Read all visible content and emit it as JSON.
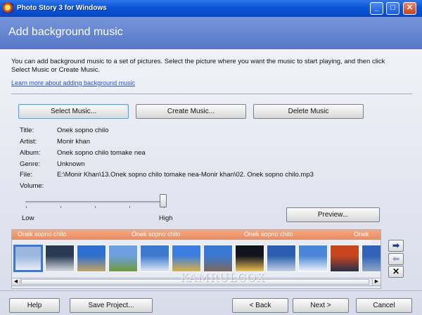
{
  "window": {
    "title": "Photo Story 3 for Windows"
  },
  "titlebar_buttons": {
    "minimize": "_",
    "maximize": "□",
    "close": "✕"
  },
  "header": {
    "title": "Add background music"
  },
  "instructions": "You can add background music to a set of pictures.  Select the picture where you want the music to start playing, and then click Select Music or Create Music.",
  "help_link": "Learn more about adding background music",
  "buttons": {
    "select_music": "Select Music...",
    "create_music": "Create Music...",
    "delete_music": "Delete Music",
    "preview": "Preview..."
  },
  "details": {
    "title_label": "Title:",
    "title": "Onek sopno chilo",
    "artist_label": "Artist:",
    "artist": "Monir khan",
    "album_label": "Album:",
    "album": "Onek sopno chilo tomake nea",
    "genre_label": "Genre:",
    "genre": "Unknown",
    "file_label": "File:",
    "file": "E:\\Monir Khan\\13.Onek sopno chilo tomake nea-Monir khan\\02. Onek sopno chilo.mp3",
    "volume_label": "Volume:"
  },
  "volume": {
    "low": "Low",
    "high": "High",
    "level_fraction": 0.98
  },
  "timeline": {
    "music_labels": [
      "Onek sopno chilo",
      "Onek sopno chilo",
      "Onek sopno chilo",
      "Onek sopno chilo"
    ],
    "thumbnails": [
      {
        "name": "winter-sky",
        "colors": [
          "#9bb7dd",
          "#e8eef8"
        ],
        "selected": true
      },
      {
        "name": "dark-clouds-sea",
        "colors": [
          "#2a3a52",
          "#d8dde4"
        ]
      },
      {
        "name": "blue-sky-field",
        "colors": [
          "#2f6fd1",
          "#c5a463"
        ]
      },
      {
        "name": "green-meadow",
        "colors": [
          "#6e9fe0",
          "#6f9a3a"
        ]
      },
      {
        "name": "cloudy-sky",
        "colors": [
          "#3e78cf",
          "#dfe8f5"
        ]
      },
      {
        "name": "golden-field",
        "colors": [
          "#3c7fe0",
          "#d9b04a"
        ]
      },
      {
        "name": "rocky-coast",
        "colors": [
          "#3a77d2",
          "#7a6a5c"
        ]
      },
      {
        "name": "sunset-glow",
        "colors": [
          "#10141d",
          "#f0c15a"
        ]
      },
      {
        "name": "storm-clouds",
        "colors": [
          "#2d5db0",
          "#c4d2e8"
        ]
      },
      {
        "name": "ice-sky",
        "colors": [
          "#4a86d8",
          "#eef3fa"
        ]
      },
      {
        "name": "red-sunset",
        "colors": [
          "#c8451e",
          "#2b2f4a"
        ]
      },
      {
        "name": "mountain-sky",
        "colors": [
          "#2f62b8",
          "#8fa8c8"
        ]
      }
    ]
  },
  "side_buttons": {
    "move_right": "➡",
    "move_left": "⬅",
    "remove": "✕"
  },
  "watermark": "KAMRULCOX",
  "nav": {
    "help": "Help",
    "save_project": "Save Project...",
    "back": "< Back",
    "next": "Next >",
    "cancel": "Cancel"
  }
}
